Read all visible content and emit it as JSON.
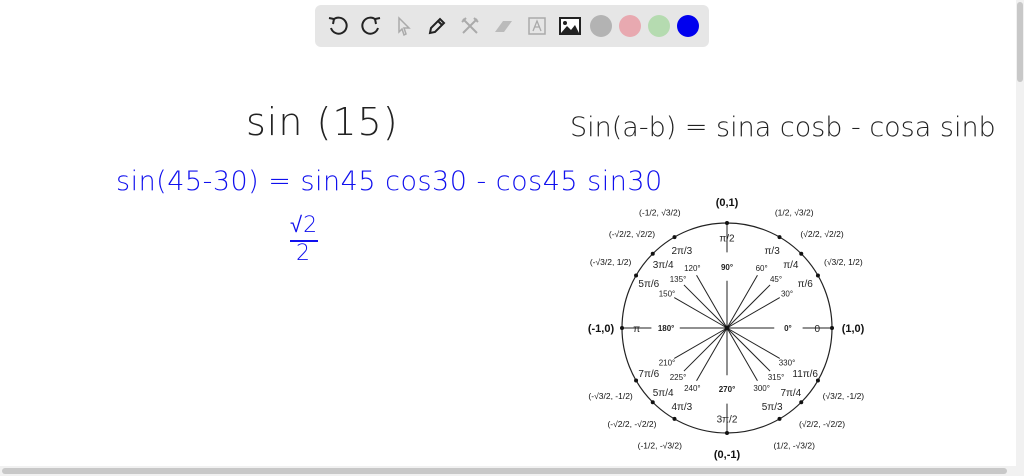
{
  "toolbar": {
    "tools": [
      "undo-icon",
      "redo-icon",
      "select-icon",
      "pen-icon",
      "tools-icon",
      "eraser-icon",
      "text-icon",
      "image-icon"
    ],
    "colors": [
      "#b3b3b3",
      "#e8a9b0",
      "#b5dbb0",
      "#0000ee"
    ]
  },
  "board": {
    "title": "sin (15)",
    "identity": "Sin(a-b) = sina cosb - cosa sinb",
    "expansion": "sin(45-30) = sin45 cos30 - cos45 sin30",
    "fraction_num": "√2",
    "fraction_den": "2",
    "ink_color": "#1010ee"
  },
  "unit_circle": {
    "angles": [
      {
        "deg": 0,
        "deg_label": "0°",
        "rad": "0",
        "point": "(1,0)"
      },
      {
        "deg": 30,
        "deg_label": "30°",
        "rad": "π/6",
        "point": "(√3/2, 1/2)"
      },
      {
        "deg": 45,
        "deg_label": "45°",
        "rad": "π/4",
        "point": "(√2/2, √2/2)"
      },
      {
        "deg": 60,
        "deg_label": "60°",
        "rad": "π/3",
        "point": "(1/2, √3/2)"
      },
      {
        "deg": 90,
        "deg_label": "90°",
        "rad": "π/2",
        "point": "(0,1)"
      },
      {
        "deg": 120,
        "deg_label": "120°",
        "rad": "2π/3",
        "point": "(-1/2, √3/2)"
      },
      {
        "deg": 135,
        "deg_label": "135°",
        "rad": "3π/4",
        "point": "(-√2/2, √2/2)"
      },
      {
        "deg": 150,
        "deg_label": "150°",
        "rad": "5π/6",
        "point": "(-√3/2, 1/2)"
      },
      {
        "deg": 180,
        "deg_label": "180°",
        "rad": "π",
        "point": "(-1,0)"
      },
      {
        "deg": 210,
        "deg_label": "210°",
        "rad": "7π/6",
        "point": "(-√3/2, -1/2)"
      },
      {
        "deg": 225,
        "deg_label": "225°",
        "rad": "5π/4",
        "point": "(-√2/2, -√2/2)"
      },
      {
        "deg": 240,
        "deg_label": "240°",
        "rad": "4π/3",
        "point": "(-1/2, -√3/2)"
      },
      {
        "deg": 270,
        "deg_label": "270°",
        "rad": "3π/2",
        "point": "(0,-1)"
      },
      {
        "deg": 300,
        "deg_label": "300°",
        "rad": "5π/3",
        "point": "(1/2, -√3/2)"
      },
      {
        "deg": 315,
        "deg_label": "315°",
        "rad": "7π/4",
        "point": "(√2/2, -√2/2)"
      },
      {
        "deg": 330,
        "deg_label": "330°",
        "rad": "11π/6",
        "point": "(√3/2, -1/2)"
      }
    ]
  }
}
